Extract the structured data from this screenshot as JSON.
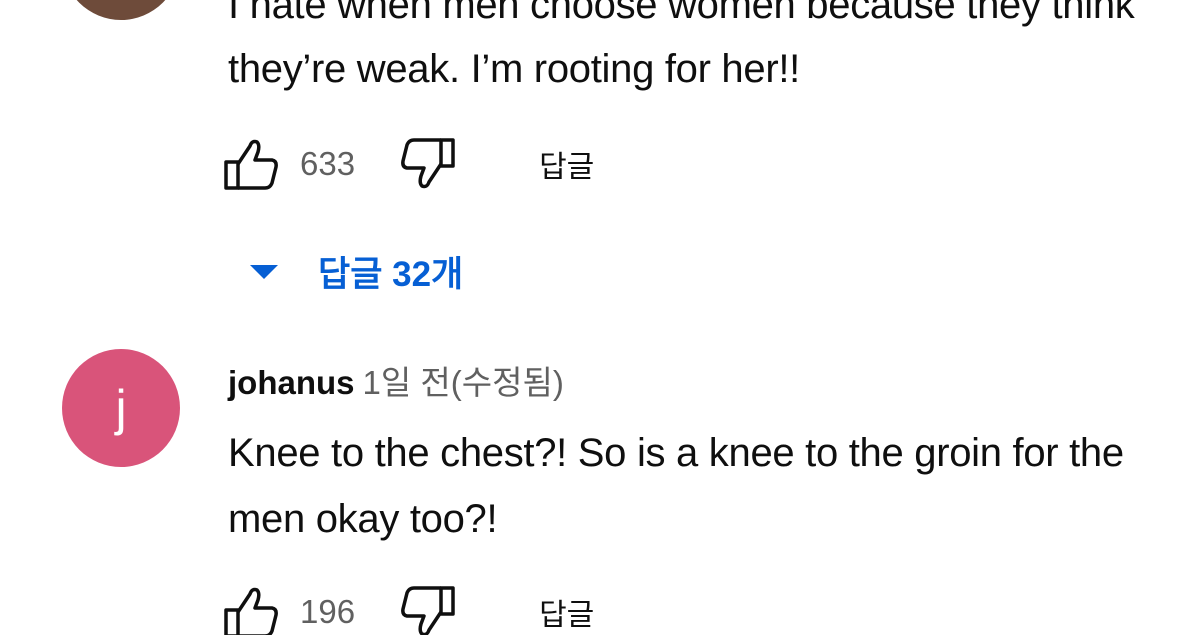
{
  "comments": [
    {
      "avatar_color": "#6e4b3a",
      "text_lines": [
        "I hate when men choose women because they think",
        "they’re weak. I’m rooting for her!!"
      ],
      "like_count": "633",
      "reply_label": "답글",
      "replies_toggle": "답글 32개",
      "icons": [
        "thumb-up-icon",
        "thumb-down-icon",
        "caret-down-icon"
      ]
    },
    {
      "avatar_letter": "j",
      "avatar_color": "#d9547a",
      "author": "johanus",
      "timestamp": "1일 전(수정됨)",
      "text_lines": [
        "Knee to the chest?! So is a knee to the groin for the",
        "men okay too?!"
      ],
      "like_count": "196",
      "reply_label": "답글",
      "icons": [
        "thumb-up-icon",
        "thumb-down-icon"
      ]
    }
  ],
  "colors": {
    "link_blue": "#065fd4",
    "secondary_text": "#606060",
    "primary_text": "#0f0f0f"
  }
}
